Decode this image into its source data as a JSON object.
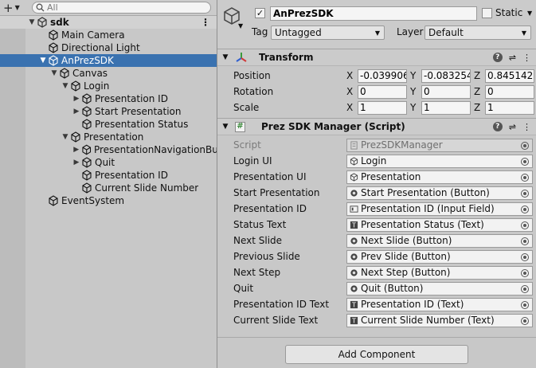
{
  "hierarchy": {
    "search_placeholder": "All",
    "scene": "sdk",
    "items": [
      {
        "label": "Main Camera",
        "depth": 1,
        "arrow": "",
        "selected": false
      },
      {
        "label": "Directional Light",
        "depth": 1,
        "arrow": "",
        "selected": false
      },
      {
        "label": "AnPrezSDK",
        "depth": 1,
        "arrow": "down",
        "selected": true
      },
      {
        "label": "Canvas",
        "depth": 2,
        "arrow": "down",
        "selected": false
      },
      {
        "label": "Login",
        "depth": 3,
        "arrow": "down",
        "selected": false
      },
      {
        "label": "Presentation ID",
        "depth": 4,
        "arrow": "right",
        "selected": false
      },
      {
        "label": "Start Presentation",
        "depth": 4,
        "arrow": "right",
        "selected": false
      },
      {
        "label": "Presentation Status",
        "depth": 4,
        "arrow": "",
        "selected": false
      },
      {
        "label": "Presentation",
        "depth": 3,
        "arrow": "down",
        "selected": false
      },
      {
        "label": "PresentationNavigationBut",
        "depth": 4,
        "arrow": "right",
        "selected": false
      },
      {
        "label": "Quit",
        "depth": 4,
        "arrow": "right",
        "selected": false
      },
      {
        "label": "Presentation ID",
        "depth": 4,
        "arrow": "",
        "selected": false
      },
      {
        "label": "Current Slide Number",
        "depth": 4,
        "arrow": "",
        "selected": false
      },
      {
        "label": "EventSystem",
        "depth": 1,
        "arrow": "",
        "selected": false
      }
    ]
  },
  "inspector": {
    "object_name": "AnPrezSDK",
    "static_label": "Static",
    "tag_label": "Tag",
    "tag_value": "Untagged",
    "layer_label": "Layer",
    "layer_value": "Default",
    "transform": {
      "title": "Transform",
      "rows": [
        {
          "label": "Position",
          "x": "-0.039906",
          "y": "-0.083254",
          "z": "0.8451429"
        },
        {
          "label": "Rotation",
          "x": "0",
          "y": "0",
          "z": "0"
        },
        {
          "label": "Scale",
          "x": "1",
          "y": "1",
          "z": "1"
        }
      ],
      "axes": {
        "x": "X",
        "y": "Y",
        "z": "Z"
      }
    },
    "script_component": {
      "title": "Prez SDK Manager (Script)",
      "fields": [
        {
          "label": "Script",
          "value": "PrezSDKManager",
          "icon": "script",
          "disabled": true
        },
        {
          "label": "Login UI",
          "value": "Login",
          "icon": "cube"
        },
        {
          "label": "Presentation UI",
          "value": "Presentation",
          "icon": "cube"
        },
        {
          "label": "Start Presentation",
          "value": "Start Presentation (Button)",
          "icon": "button"
        },
        {
          "label": "Presentation ID",
          "value": "Presentation ID (Input Field)",
          "icon": "input"
        },
        {
          "label": "Status Text",
          "value": "Presentation Status (Text)",
          "icon": "text"
        },
        {
          "label": "Next Slide",
          "value": "Next Slide (Button)",
          "icon": "button"
        },
        {
          "label": "Previous Slide",
          "value": "Prev Slide (Button)",
          "icon": "button"
        },
        {
          "label": "Next Step",
          "value": "Next Step (Button)",
          "icon": "button"
        },
        {
          "label": "Quit",
          "value": "Quit (Button)",
          "icon": "button"
        },
        {
          "label": "Presentation ID Text",
          "value": "Presentation ID (Text)",
          "icon": "text"
        },
        {
          "label": "Current Slide Text",
          "value": "Current Slide Number (Text)",
          "icon": "text"
        }
      ]
    },
    "add_component_label": "Add Component"
  },
  "colors": {
    "selection": "#3a72b0",
    "panel": "#c8c8c8"
  }
}
